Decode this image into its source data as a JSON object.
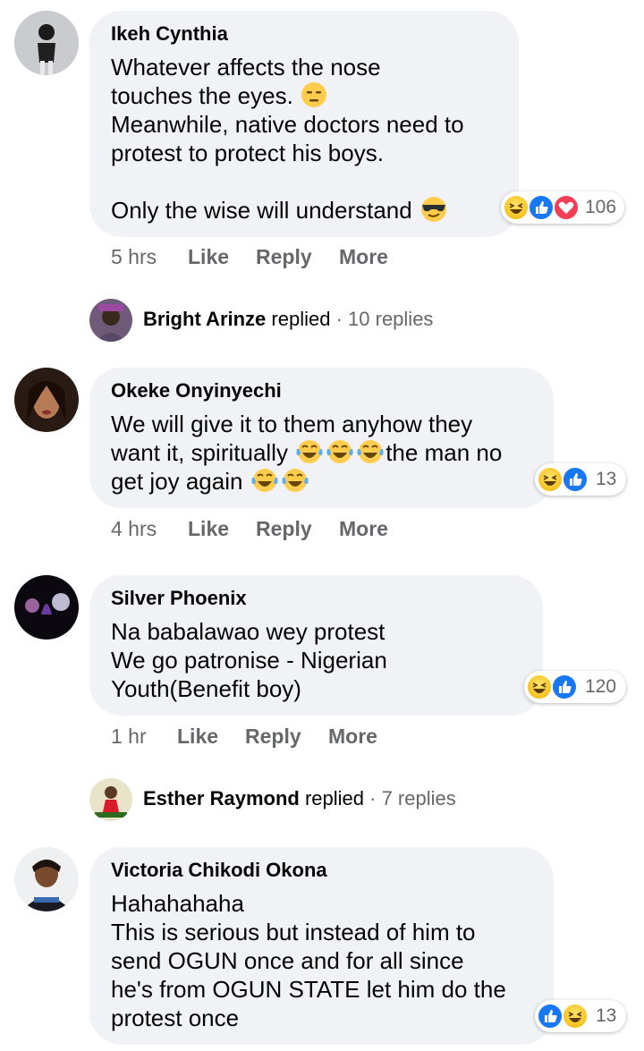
{
  "comments": [
    {
      "author": "Ikeh Cynthia",
      "lines": [
        "Whatever affects the nose",
        "touches the eyes.",
        "Meanwhile, native doctors need to",
        "protest to protect his boys.",
        "",
        "Only the wise will understand"
      ],
      "reaction_count": "106",
      "time": "5 hrs",
      "actions": [
        "Like",
        "Reply",
        "More"
      ]
    },
    {
      "author": "Okeke Onyinyechi",
      "lines": [
        "We will give it to them anyhow they",
        "want it, spiritually",
        "the man no",
        "get joy again"
      ],
      "reaction_count": "13",
      "time": "4 hrs",
      "actions": [
        "Like",
        "Reply",
        "More"
      ]
    },
    {
      "author": "Silver Phoenix",
      "lines": [
        "Na babalawao wey protest",
        "We go patronise - Nigerian",
        "Youth(Benefit boy)"
      ],
      "reaction_count": "120",
      "time": "1 hr",
      "actions": [
        "Like",
        "Reply",
        "More"
      ]
    },
    {
      "author": "Victoria Chikodi Okona",
      "lines": [
        "Hahahahaha",
        "This is serious but instead of him to",
        "send OGUN once and for all since",
        "he's from OGUN STATE let him do the",
        "protest once"
      ],
      "reaction_count": "13"
    }
  ],
  "replies": [
    {
      "name": "Bright Arinze",
      "verb": "replied",
      "count": "· 10 replies"
    },
    {
      "name": "Esther Raymond",
      "verb": "replied",
      "count": "· 7 replies"
    }
  ],
  "icons": {
    "expressionless": "expressionless-emoji-icon",
    "cool": "sunglasses-emoji-icon",
    "tears_of_joy": "tears-of-joy-emoji-icon",
    "haha": "haha-reaction-icon",
    "like": "like-reaction-icon",
    "love": "love-reaction-icon"
  },
  "colors": {
    "bubble": "#f0f2f5",
    "meta_text": "#65676b",
    "like_blue": "#1877f2",
    "love_red": "#f33e58",
    "haha_yellow": "#f7c84a"
  }
}
